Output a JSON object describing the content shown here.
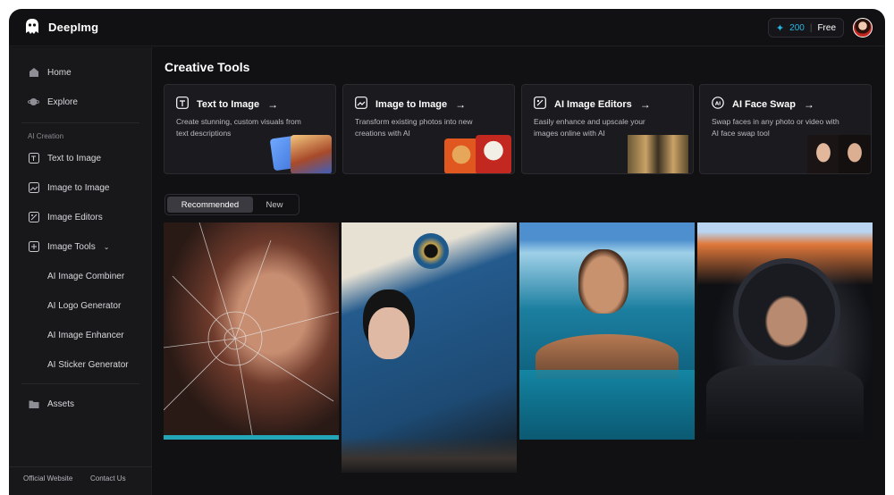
{
  "app": {
    "name": "DeepImg"
  },
  "header": {
    "credits": "200",
    "plan": "Free"
  },
  "sidebar": {
    "items": [
      {
        "label": "Home",
        "icon": "home-icon"
      },
      {
        "label": "Explore",
        "icon": "planet-icon"
      }
    ],
    "section_label": "AI Creation",
    "creation_items": [
      {
        "label": "Text to Image",
        "icon": "text-image-icon"
      },
      {
        "label": "Image to Image",
        "icon": "image-image-icon"
      },
      {
        "label": "Image Editors",
        "icon": "image-edit-icon"
      },
      {
        "label": "Image Tools",
        "icon": "image-tools-icon"
      }
    ],
    "tool_items": [
      {
        "label": "AI Image Combiner"
      },
      {
        "label": "AI Logo Generator"
      },
      {
        "label": "AI Image Enhancer"
      },
      {
        "label": "AI Sticker Generator"
      }
    ],
    "assets": {
      "label": "Assets",
      "icon": "folder-icon"
    },
    "footer": {
      "website": "Official Website",
      "contact": "Contact Us"
    }
  },
  "main": {
    "title": "Creative Tools",
    "cards": [
      {
        "title": "Text to Image",
        "desc": "Create stunning, custom visuals from text descriptions"
      },
      {
        "title": "Image to Image",
        "desc": "Transform existing photos into new creations with AI"
      },
      {
        "title": "AI Image Editors",
        "desc": "Easily enhance and upscale your images online with AI"
      },
      {
        "title": "AI Face Swap",
        "desc": "Swap faces in any photo or video with AI face swap tool"
      }
    ],
    "tabs": {
      "recommended": "Recommended",
      "new": "New"
    }
  },
  "colors": {
    "accent": "#23b8e6",
    "background": "#111113",
    "sidebar": "#18181b"
  }
}
